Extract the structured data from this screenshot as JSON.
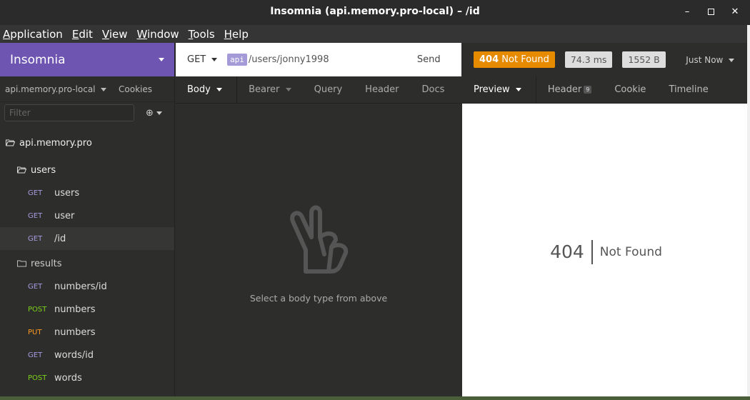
{
  "window": {
    "title": "Insomnia (api.memory.pro-local) – /id"
  },
  "menu": {
    "items": [
      "Application",
      "Edit",
      "View",
      "Window",
      "Tools",
      "Help"
    ]
  },
  "sidebar": {
    "app_name": "Insomnia",
    "environment": "api.memory.pro-local",
    "cookies": "Cookies",
    "filter_placeholder": "Filter",
    "tree": {
      "root": "api.memory.pro",
      "folders": [
        {
          "name": "users",
          "requests": [
            {
              "method": "GET",
              "name": "users"
            },
            {
              "method": "GET",
              "name": "user"
            },
            {
              "method": "GET",
              "name": "/id"
            }
          ]
        },
        {
          "name": "results",
          "requests": [
            {
              "method": "GET",
              "name": "numbers/id"
            },
            {
              "method": "POST",
              "name": "numbers"
            },
            {
              "method": "PUT",
              "name": "numbers"
            },
            {
              "method": "GET",
              "name": "words/id"
            },
            {
              "method": "POST",
              "name": "words"
            }
          ]
        }
      ]
    }
  },
  "request": {
    "method": "GET",
    "url_tag": "api",
    "url_path": "/users/jonny1998",
    "send_label": "Send",
    "tabs": [
      "Body",
      "Bearer",
      "Query",
      "Header",
      "Docs"
    ],
    "body_empty_text": "Select a body type from above"
  },
  "response": {
    "status_code": "404",
    "status_text": "Not Found",
    "time": "74.3 ms",
    "size": "1552 B",
    "timestamp": "Just Now",
    "tabs": [
      "Preview",
      "Header",
      "Cookie",
      "Timeline"
    ],
    "header_count": "9",
    "body_code": "404",
    "body_message": "Not Found"
  },
  "colors": {
    "accent": "#6d55b1",
    "status_404": "#e68a00",
    "method_get": "#a99be0",
    "method_post": "#7dd21a",
    "method_put": "#ff9b21"
  }
}
